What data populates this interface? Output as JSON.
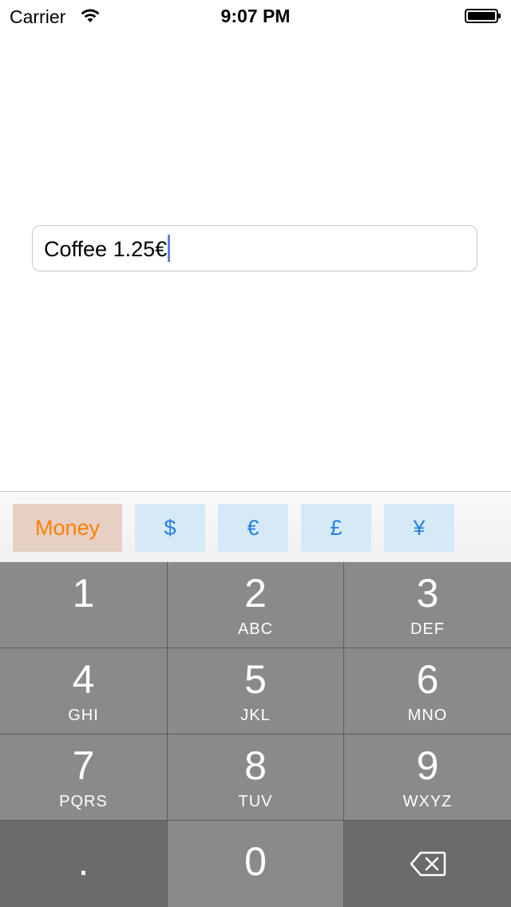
{
  "status_bar": {
    "carrier": "Carrier",
    "time": "9:07 PM",
    "wifi_icon": "wifi-icon",
    "battery_icon": "battery-icon"
  },
  "text_field": {
    "value": "Coffee 1.25€"
  },
  "accessory_bar": {
    "money_label": "Money",
    "currencies": [
      "$",
      "€",
      "£",
      "¥"
    ]
  },
  "keypad": {
    "keys": [
      {
        "number": "1",
        "letters": ""
      },
      {
        "number": "2",
        "letters": "ABC"
      },
      {
        "number": "3",
        "letters": "DEF"
      },
      {
        "number": "4",
        "letters": "GHI"
      },
      {
        "number": "5",
        "letters": "JKL"
      },
      {
        "number": "6",
        "letters": "MNO"
      },
      {
        "number": "7",
        "letters": "PQRS"
      },
      {
        "number": "8",
        "letters": "TUV"
      },
      {
        "number": "9",
        "letters": "WXYZ"
      }
    ],
    "decimal": ".",
    "zero": "0",
    "delete_icon": "delete-backspace-icon"
  },
  "colors": {
    "money_text": "#ff7f00",
    "money_bg": "#e6cfc3",
    "currency_text": "#2a7fe0",
    "currency_bg": "#d5e9f7",
    "caret": "#5e7fe0",
    "key_light": "#8a8a8a",
    "key_dark": "#6b6b6b"
  }
}
